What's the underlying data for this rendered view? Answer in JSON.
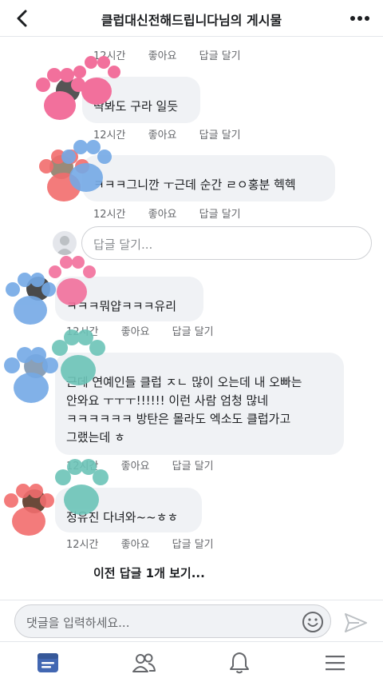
{
  "header": {
    "title": "클럽대신전해드립니다님의 게시물"
  },
  "meta_labels": {
    "time": "12시간",
    "like": "좋아요",
    "reply": "답글 달기"
  },
  "comments": [
    {
      "name": "",
      "text": "딱봐도 구라 일듯"
    },
    {
      "name": "",
      "text": "ㅋㅋㅋ그니깐 ㅜ근데 순간 ㄹㅇ홍분 헥헥"
    },
    {
      "name": "",
      "text": "ㅋㅋㅋ뭐얍ㅋㅋㅋ유리"
    },
    {
      "name": "",
      "text_lines": [
        "근데 연예인들 클럽 ㅈㄴ 많이 오는데 내 오빠는",
        "안와요 ㅜㅜㅜ!!!!!! 이런 사람 엄청 많네",
        "ㅋㅋㅋㅋㅋㅋ 방탄은 몰라도 엑소도 클럽가고",
        "그랬는데 ㅎ"
      ]
    },
    {
      "name": "",
      "text": "정유진 다녀와~~ㅎㅎ"
    }
  ],
  "reply_input": {
    "placeholder": "답글 달기..."
  },
  "view_previous": "이전 답글 1개 보기...",
  "composer": {
    "placeholder": "댓글을 입력하세요..."
  },
  "colors": {
    "bubble": "#f0f2f5",
    "accent": "#4267b2",
    "meta": "#65676b",
    "paw_pink": "#f2709c",
    "paw_blue": "#74a9e6",
    "paw_teal": "#6cc4b8",
    "paw_coral": "#f26d6d"
  },
  "tabs": [
    "news-feed-icon",
    "friends-icon",
    "notifications-icon",
    "menu-icon"
  ]
}
